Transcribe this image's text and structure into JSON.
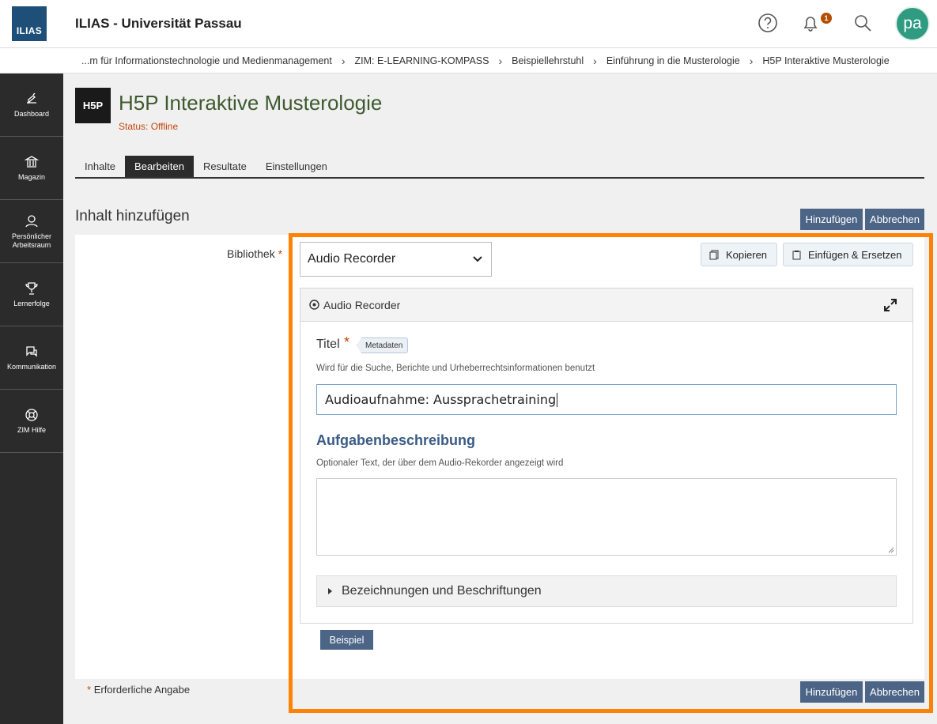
{
  "header": {
    "logo_text": "ILIAS",
    "app_title": "ILIAS - Universität Passau",
    "notification_count": "1",
    "avatar_initials": "pa",
    "icons": [
      "help-icon",
      "bell-icon",
      "search-icon"
    ]
  },
  "breadcrumb": [
    "...m für Informationstechnologie und Medienmanagement",
    "ZIM: E-LEARNING-KOMPASS",
    "Beispiellehrstuhl",
    "Einführung in die Musterologie",
    "H5P Interaktive Musterologie"
  ],
  "sidebar": {
    "items": [
      {
        "label": "Dashboard",
        "icon": "dashboard-icon"
      },
      {
        "label": "Magazin",
        "icon": "bank-icon"
      },
      {
        "label": "Persönlicher Arbeitsraum",
        "icon": "user-icon"
      },
      {
        "label": "Lernerfolge",
        "icon": "trophy-icon"
      },
      {
        "label": "Kommunikation",
        "icon": "chat-icon"
      },
      {
        "label": "ZIM Hilfe",
        "icon": "lifebuoy-icon"
      }
    ]
  },
  "object": {
    "icon_text": "H5P",
    "title": "H5P Interaktive Musterologie",
    "status": "Status: Offline"
  },
  "tabs": [
    {
      "label": "Inhalte",
      "active": false
    },
    {
      "label": "Bearbeiten",
      "active": true
    },
    {
      "label": "Resultate",
      "active": false
    },
    {
      "label": "Einstellungen",
      "active": false
    }
  ],
  "form": {
    "section_title": "Inhalt hinzufügen",
    "add_label": "Hinzufügen",
    "cancel_label": "Abbrechen",
    "library_label": "Bibliothek",
    "required_star": "*",
    "required_note": "Erforderliche Angabe"
  },
  "editor": {
    "library_selected": "Audio Recorder",
    "copy_label": "Kopieren",
    "paste_label": "Einfügen & Ersetzen",
    "library_heading": "Audio Recorder",
    "title_label": "Titel",
    "metadata_label": "Metadaten",
    "title_help": "Wird für die Suche, Berichte und Urheberrechtsinformationen benutzt",
    "title_value": "Audioaufnahme: Aussprachetraining",
    "description_label": "Aufgabenbeschreibung",
    "description_help": "Optionaler Text, der über dem Audio-Rekorder angezeigt wird",
    "description_value": "",
    "collapsible_label": "Bezeichnungen und Beschriftungen",
    "example_label": "Beispiel"
  },
  "colors": {
    "accent_highlight": "#ff8205",
    "button": "#4c6586",
    "sidebar": "#2b2b2b",
    "title_green": "#3e5a2e",
    "status_orange": "#c4470b",
    "label_blue": "#3a5b85"
  }
}
